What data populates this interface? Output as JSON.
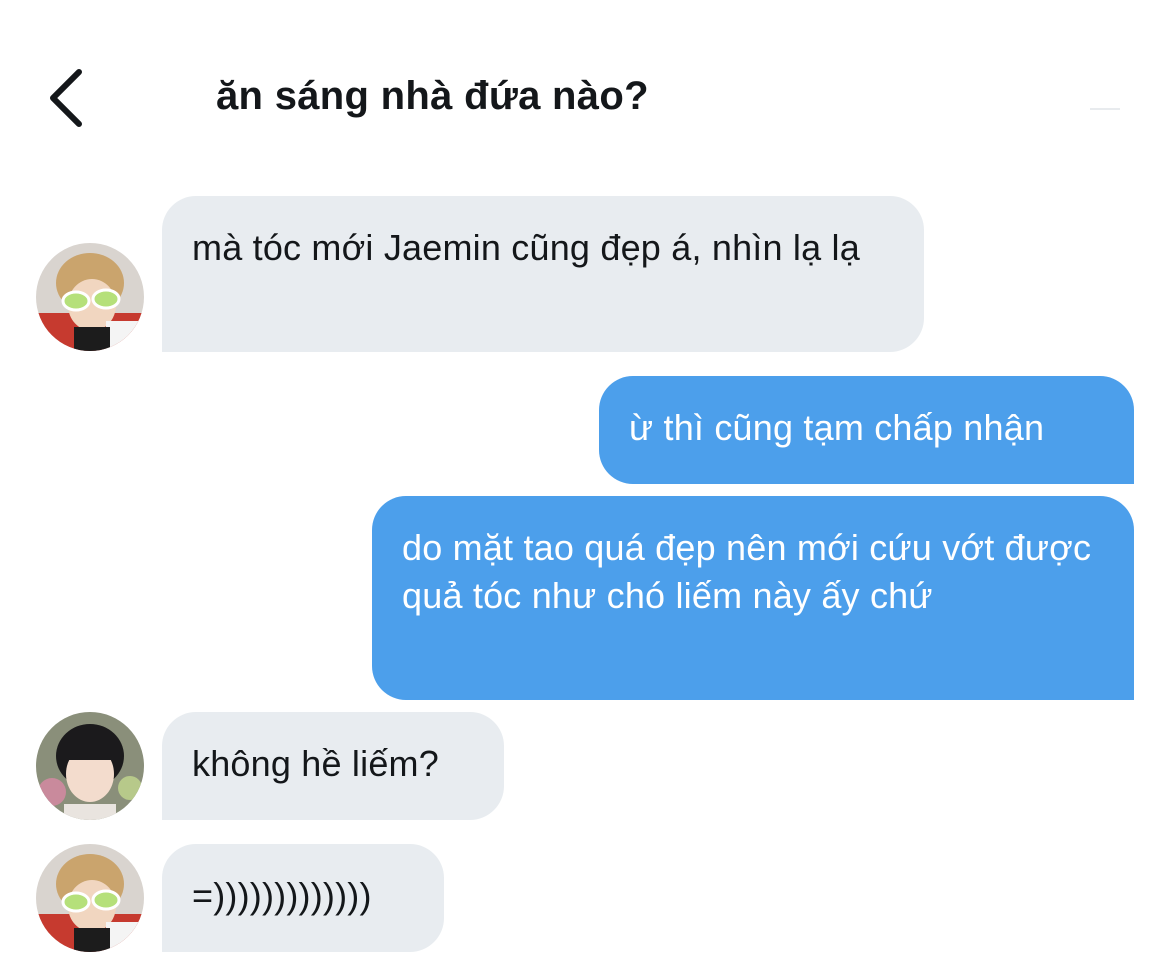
{
  "header": {
    "title": "ăn sáng nhà đứa nào?",
    "back_icon": "chevron-left-icon"
  },
  "colors": {
    "sent_bubble": "#4c9feb",
    "received_bubble": "#e8ecf0",
    "text_dark": "#14171a",
    "text_light": "#ffffff"
  },
  "messages": [
    {
      "direction": "received",
      "avatar": "avatar-user-1",
      "text": "mà tóc mới Jaemin cũng đẹp á, nhìn lạ lạ"
    },
    {
      "direction": "sent",
      "text": "ừ thì cũng tạm chấp nhận"
    },
    {
      "direction": "sent",
      "text": "do mặt tao quá đẹp nên mới cứu vớt được quả tóc như chó liếm này ấy chứ"
    },
    {
      "direction": "received",
      "avatar": "avatar-user-2",
      "text": "không hề liếm?"
    },
    {
      "direction": "received",
      "avatar": "avatar-user-1",
      "text": "=)))))))))))))"
    }
  ]
}
